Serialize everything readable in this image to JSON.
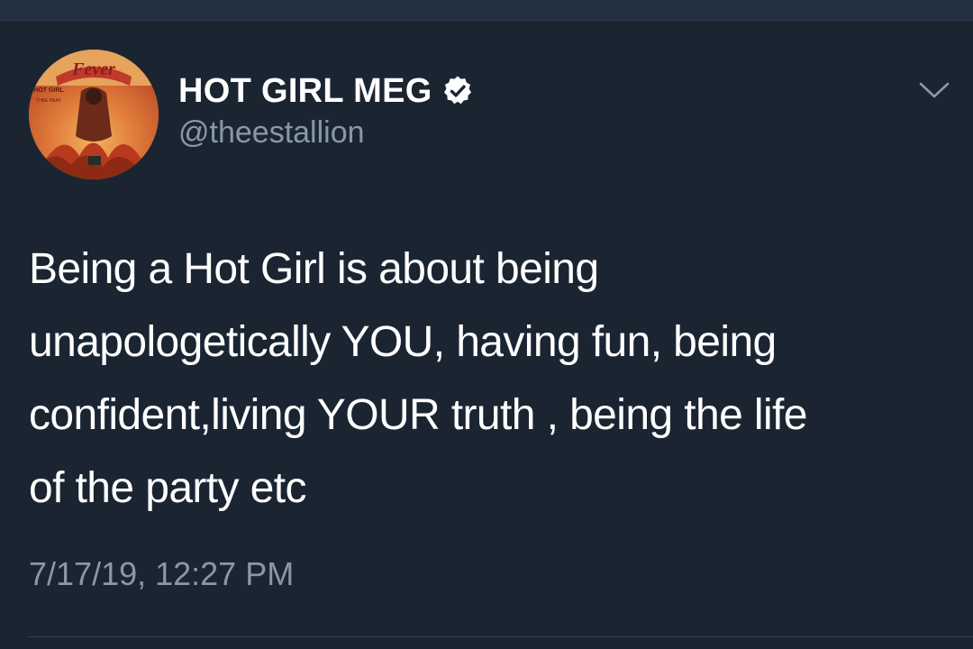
{
  "tweet": {
    "display_name": "HOT GIRL MEG",
    "handle": "@theestallion",
    "verified": true,
    "text_lines": [
      "Being a Hot Girl is about being",
      "unapologetically YOU, having fun, being",
      "confident,living YOUR truth , being the life",
      "of the party etc"
    ],
    "timestamp": "7/17/19, 12:27 PM"
  },
  "avatar": {
    "title_text": "Fever",
    "side_text_1": "HOT GIRL",
    "side_text_2": "THEE HEAT"
  },
  "icons": {
    "verified": "verified-badge-icon",
    "menu": "chevron-down-icon"
  },
  "colors": {
    "background": "#1b2532",
    "primary_text": "#ffffff",
    "secondary_text": "#8899a6",
    "divider": "#38444d"
  }
}
